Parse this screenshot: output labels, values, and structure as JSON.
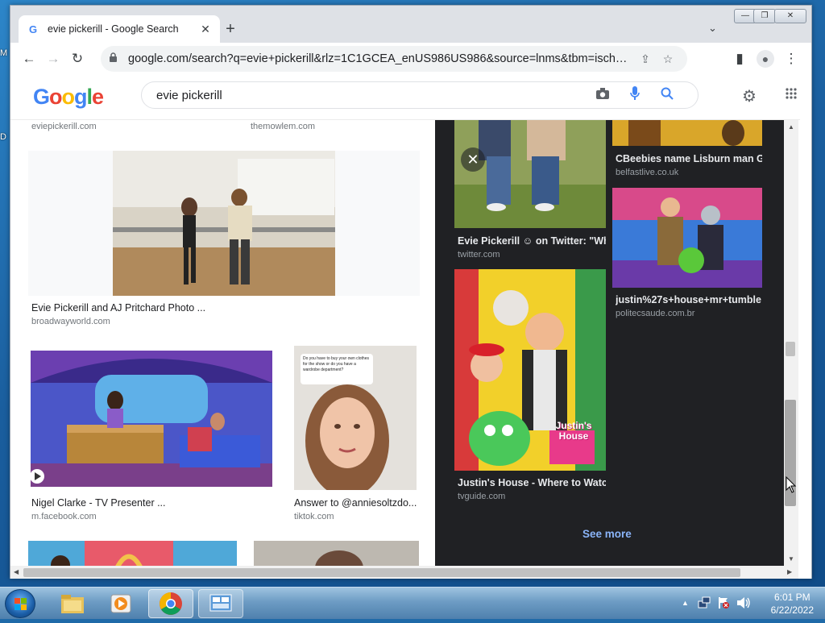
{
  "desktop": {
    "edge_letters": [
      "M",
      "D"
    ]
  },
  "window_controls": [
    "—",
    "❐",
    "✕"
  ],
  "browser": {
    "tab": {
      "title": "evie pickerill - Google Search",
      "close": "✕"
    },
    "new_tab": "+",
    "tab_dropdown": "⌄",
    "nav": {
      "back": "←",
      "forward": "→",
      "reload": "↻"
    },
    "url": "google.com/search?q=evie+pickerill&rlz=1C1GCEA_enUS986US986&source=lnms&tbm=isch&sa=X&ved...",
    "toolbar_icons": {
      "share": "⇪",
      "star": "☆",
      "side_panel": "▮",
      "profile": "●",
      "menu": "⋮"
    }
  },
  "google": {
    "logo_letters": [
      "G",
      "o",
      "o",
      "g",
      "l",
      "e"
    ],
    "logo_colors": [
      "#4285f4",
      "#ea4335",
      "#fbbc05",
      "#4285f4",
      "#34a853",
      "#ea4335"
    ],
    "query": "evie pickerill",
    "settings_icon": "⚙",
    "apps_icon": "⋮⋮"
  },
  "results": {
    "top_sources": [
      "eviepickerill.com",
      "themowlem.com"
    ],
    "items": [
      {
        "caption": "Evie Pickerill and AJ Pritchard Photo ...",
        "source": "broadwayworld.com"
      },
      {
        "caption": "Nigel Clarke - TV Presenter ...",
        "source": "m.facebook.com"
      },
      {
        "caption": "Answer to @anniesoltzdo...",
        "source": "tiktok.com"
      }
    ],
    "tiktok_overlay": "Do you have to buy your own clothes for the show or do you have a wardrobe department?"
  },
  "related": {
    "close": "✕",
    "items": [
      {
        "caption": "Evie Pickerill ☺ on Twitter: \"Wh...",
        "source": "twitter.com"
      },
      {
        "caption": "CBeebies name Lisburn man G...",
        "source": "belfastlive.co.uk"
      },
      {
        "caption": "justin%27s+house+mr+tumble ...",
        "source": "politecsaude.com.br"
      },
      {
        "caption": "Justin's House - Where to Watc...",
        "source": "tvguide.com"
      }
    ],
    "house_sign": "Justin's House",
    "see_more": "See more"
  },
  "taskbar": {
    "time": "6:01 PM",
    "date": "6/22/2022"
  }
}
